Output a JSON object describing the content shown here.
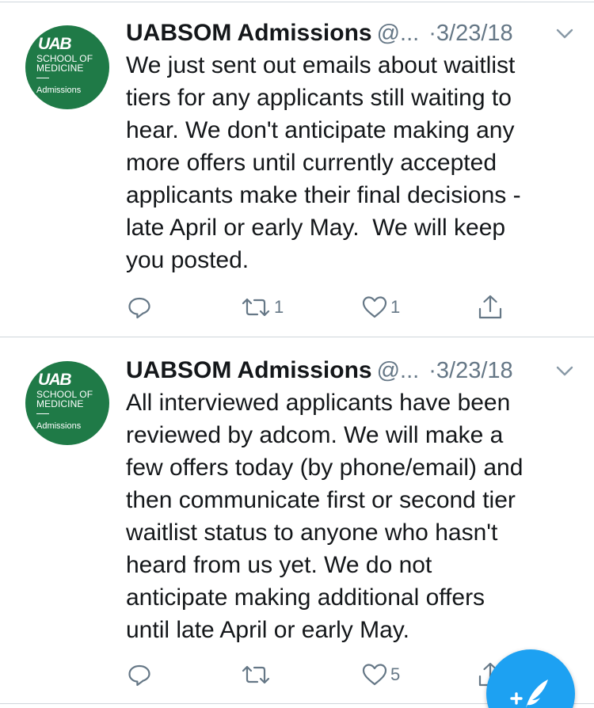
{
  "tweets": [
    {
      "avatar": {
        "logo": "UAB",
        "line1": "SCHOOL OF",
        "line2": "MEDICINE",
        "subtitle": "Admissions"
      },
      "name": "UABSOM Admissions",
      "handle": "@...",
      "separator": "·",
      "date": "3/23/18",
      "text": "We just sent out emails about waitlist\ntiers for any applicants still waiting to\nhear. We don't anticipate making any\nmore offers until currently accepted\napplicants make their final decisions -\nlate April or early May.  We will keep\nyou posted.",
      "reply_count": "",
      "retweet_count": "1",
      "like_count": "1"
    },
    {
      "avatar": {
        "logo": "UAB",
        "line1": "SCHOOL OF",
        "line2": "MEDICINE",
        "subtitle": "Admissions"
      },
      "name": "UABSOM Admissions",
      "handle": "@...",
      "separator": "·",
      "date": "3/23/18",
      "text": "All interviewed applicants have been\nreviewed by adcom. We will make a\nfew offers today (by phone/email) and\nthen communicate first or second tier\nwaitlist status to anyone who hasn't\nheard from us yet. We do not\nanticipate making additional offers\nuntil late April or early May.",
      "reply_count": "",
      "retweet_count": "",
      "like_count": "5"
    }
  ],
  "icons": {
    "reply": "reply-icon",
    "retweet": "retweet-icon",
    "like": "heart-icon",
    "share": "share-icon",
    "caret": "chevron-down-icon",
    "compose": "compose-tweet-icon"
  },
  "colors": {
    "text": "#14171a",
    "secondary": "#657786",
    "avatar_green": "#1f7a47",
    "brand_blue": "#1da1f2",
    "divider": "#cfd6db"
  }
}
